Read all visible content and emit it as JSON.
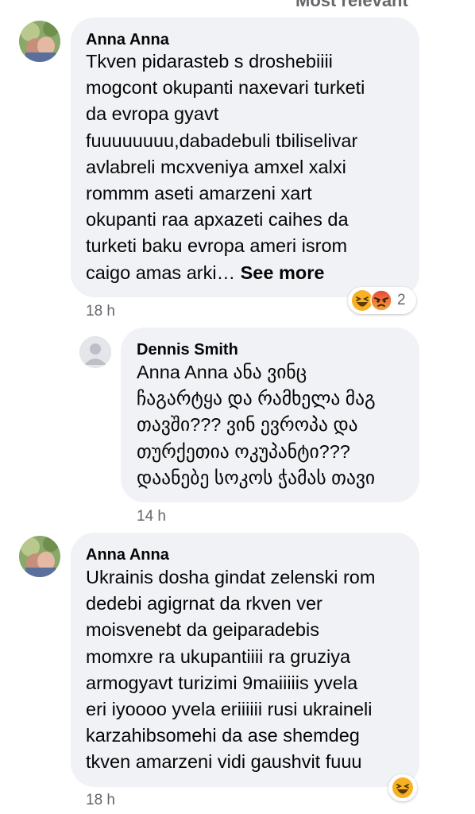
{
  "top_cut_text": "Most relevant",
  "comments": [
    {
      "author": "Anna Anna",
      "lines": [
        "Tkven pidarasteb s droshebiiii",
        "mogcont okupanti naxevari turketi",
        "da evropa gyavt",
        "fuuuuuuuu,dabadebuli tbiliselivar",
        "avlabreli mcxveniya amxel xalxi",
        "rommm aseti amarzeni xart",
        "okupanti raa apxazeti caihes da",
        "turketi baku evropa ameri isrom",
        "caigo amas arki…"
      ],
      "see_more": "See more",
      "time": "18 h",
      "reactions": {
        "icons": [
          "haha-icon",
          "angry-icon"
        ],
        "count": "2"
      }
    },
    {
      "author": "Dennis Smith",
      "lines": [
        "Anna Anna ანა ვინც",
        "ჩაგარტყა და რამხელა მაგ",
        "თავში??? ვინ ევროპა და",
        "თურქეთია ოკუპანტი???",
        "დაანებე სოკოს ჭამას თავი"
      ],
      "time": "14 h"
    },
    {
      "author": "Anna Anna",
      "lines": [
        "Ukrainis dosha gindat zelenski rom",
        "dedebi agigrnat da rkven ver",
        "moisvenebt da geiparadebis",
        "momxre ra ukupantiiii ra gruziya",
        "armogyavt turizimi 9maiiiiis yvela",
        "eri iyoooo yvela eriiiiii rusi ukraineli",
        "karzahibsomehi da ase shemdeg",
        "tkven amarzeni vidi gaushvit fuuu"
      ],
      "time": "18 h",
      "reactions": {
        "icons": [
          "haha-icon"
        ]
      }
    }
  ],
  "colors": {
    "bubble": "#f0f2f5",
    "meta": "#65676b",
    "haha": "#f7b125",
    "angry": "#e9710f"
  }
}
